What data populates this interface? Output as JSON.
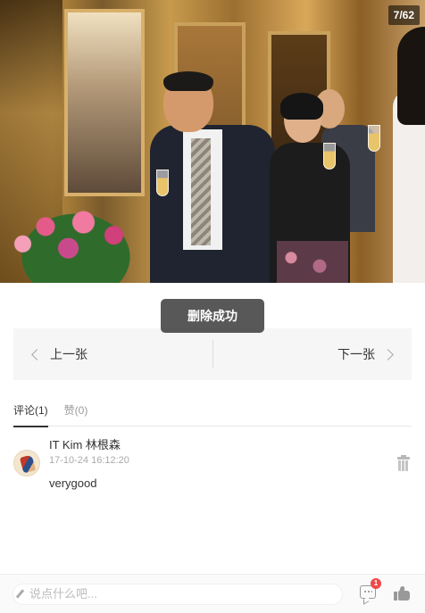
{
  "photo": {
    "counter": "7/62"
  },
  "toast": {
    "message": "删除成功"
  },
  "pager": {
    "prev_label": "上一张",
    "next_label": "下一张"
  },
  "tabs": [
    {
      "label": "评论(1)",
      "active": true
    },
    {
      "label": "赞(0)",
      "active": false
    }
  ],
  "comments": [
    {
      "author": "IT Kim 林根森",
      "time": "17-10-24 16:12:20",
      "text": "verygood"
    }
  ],
  "bottom": {
    "input_placeholder": "说点什么吧...",
    "comment_badge": "1"
  },
  "colors": {
    "badge": "#f04848",
    "toast_bg": "#464646",
    "pager_bg": "#f6f6f6"
  }
}
